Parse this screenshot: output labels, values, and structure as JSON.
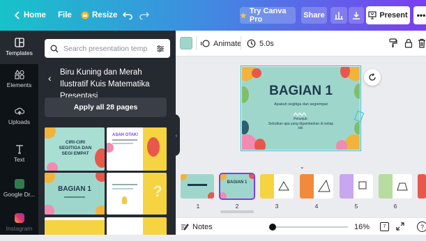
{
  "topbar": {
    "home": "Home",
    "file": "File",
    "resize": "Resize",
    "try_pro": "Try Canva Pro",
    "share": "Share",
    "present": "Present",
    "more": "•••"
  },
  "rail": [
    {
      "label": "Templates",
      "icon": "templates-icon"
    },
    {
      "label": "Elements",
      "icon": "elements-icon"
    },
    {
      "label": "Uploads",
      "icon": "uploads-icon"
    },
    {
      "label": "Text",
      "icon": "text-icon"
    },
    {
      "label": "Google Dr...",
      "icon": "google-drive-icon"
    },
    {
      "label": "Instagram",
      "icon": "instagram-icon"
    }
  ],
  "panel": {
    "search_placeholder": "Search presentation templates",
    "template_title": "Biru Kuning dan Merah Ilustratif Kuis Matematika Presentasi",
    "apply_label": "Apply all 28 pages",
    "thumbs": [
      {
        "text": "CIRI-CIRI SEGITIGA DAN SEGI EMPAT"
      },
      {
        "text": "ASAH OTAK!"
      },
      {
        "text": "BAGIAN 1"
      },
      {
        "text": "?"
      }
    ]
  },
  "toolbar": {
    "animate": "Animate",
    "duration": "5.0s"
  },
  "canvas": {
    "title": "BAGIAN 1",
    "subtitle": "Apakah segitiga dan segiempat",
    "note": "Petunjuk:\nSebutkan apa yang digambarkan di setiap sisi."
  },
  "pages": [
    {
      "num": "1"
    },
    {
      "num": "2"
    },
    {
      "num": "3"
    },
    {
      "num": "4"
    },
    {
      "num": "5"
    },
    {
      "num": "6"
    }
  ],
  "bottom": {
    "notes": "Notes",
    "zoom": "16%",
    "page_count": "7",
    "help": "?"
  },
  "colors": {
    "topbar_start": "#17c3c9",
    "topbar_end": "#7a3ff0",
    "canvas_bg": "#9fd6cc",
    "selection": "#31c3d0",
    "panel_bg": "#252a31",
    "rail_bg": "#0e1318"
  }
}
